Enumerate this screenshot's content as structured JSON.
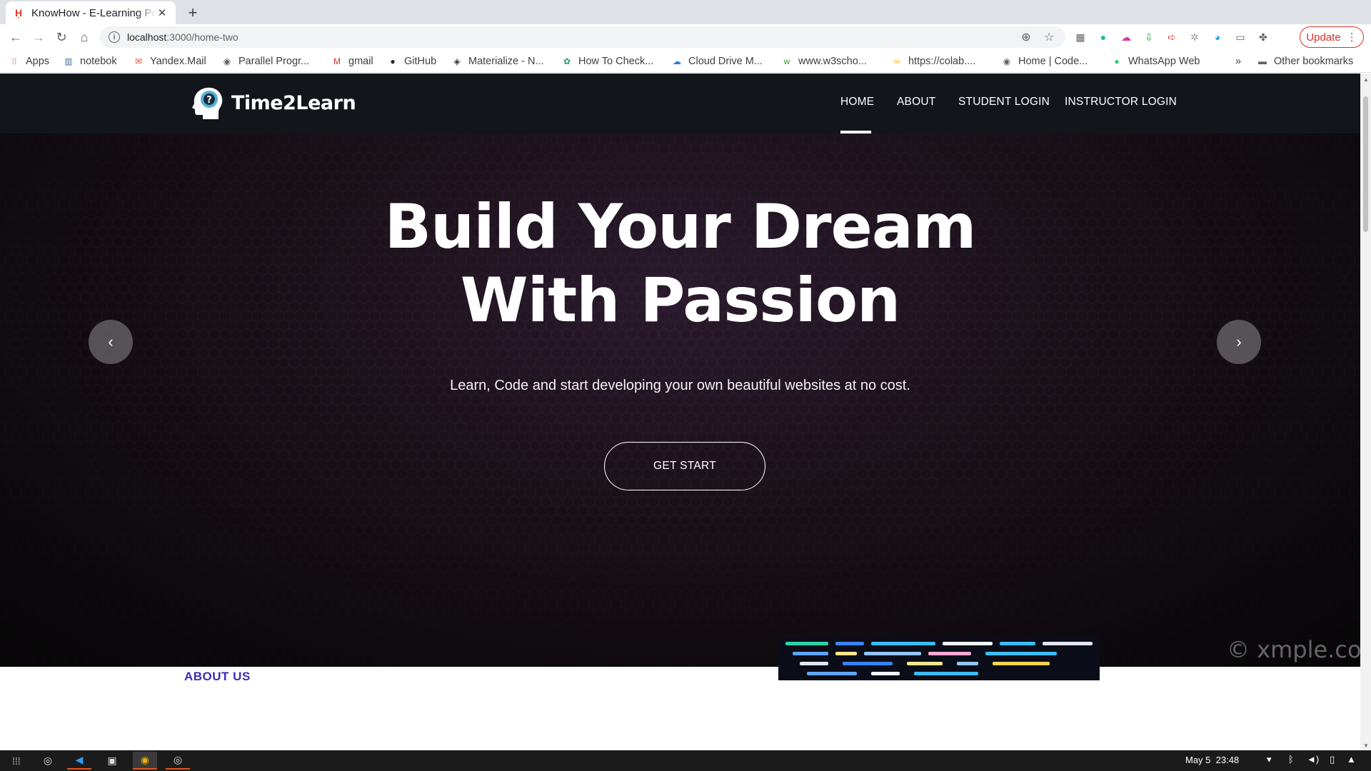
{
  "browser": {
    "tab_title": "KnowHow - E-Learning Portal",
    "url_host": "localhost",
    "url_path": ":3000/home-two",
    "update_label": "Update"
  },
  "bookmarks": [
    {
      "label": "Apps",
      "icon": "apps-grid-icon"
    },
    {
      "label": "notebok",
      "icon": "document-icon"
    },
    {
      "label": "Yandex.Mail",
      "icon": "mail-icon"
    },
    {
      "label": "Parallel Progr...",
      "icon": "globe-icon"
    },
    {
      "label": "gmail",
      "icon": "gmail-icon"
    },
    {
      "label": "GitHub",
      "icon": "github-icon"
    },
    {
      "label": "Materialize - N...",
      "icon": "materialize-icon"
    },
    {
      "label": "How To Check...",
      "icon": "site-icon"
    },
    {
      "label": "Cloud Drive M...",
      "icon": "cloud-icon"
    },
    {
      "label": "www.w3scho...",
      "icon": "w3schools-icon"
    },
    {
      "label": "https://colab....",
      "icon": "colab-icon"
    },
    {
      "label": "Home | Code...",
      "icon": "globe-icon"
    },
    {
      "label": "WhatsApp Web",
      "icon": "whatsapp-icon"
    }
  ],
  "bookmarks_more": "»",
  "other_bookmarks": "Other bookmarks",
  "site": {
    "brand": "Time2Learn",
    "nav": [
      "HOME",
      "ABOUT",
      "STUDENT LOGIN",
      "INSTRUCTOR LOGIN"
    ],
    "active_nav": "HOME"
  },
  "hero": {
    "title_line1": "Build Your Dream",
    "title_line2": "With Passion",
    "subtitle": "Learn, Code and start developing your own beautiful websites at no cost.",
    "cta": "GET START",
    "watermark": "© xmple.com"
  },
  "about": {
    "label": "ABOUT US"
  },
  "taskbar": {
    "date": "May 5",
    "time": "23:48"
  },
  "colors": {
    "header_bg": "#12161b",
    "about_label": "#3b2bb8",
    "update_red": "#d93025"
  }
}
